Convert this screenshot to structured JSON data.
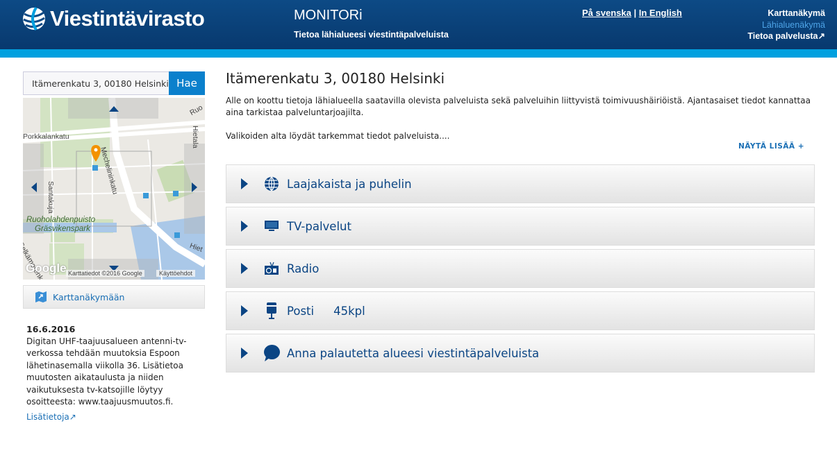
{
  "header": {
    "brand": "Viestintävirasto",
    "app_title": "MONITORi",
    "subtitle": "Tietoa lähialueesi viestintäpalveluista",
    "lang": {
      "swedish": "På svenska",
      "separator": "|",
      "english": "In English"
    },
    "nav": [
      {
        "label": "Karttanäkymä",
        "active": false
      },
      {
        "label": "Lähialuenäkymä",
        "active": true
      },
      {
        "label": "Tietoa palvelusta",
        "external": true
      }
    ]
  },
  "search": {
    "value": "Itämerenkatu 3, 00180 Helsinki",
    "button": "Hae"
  },
  "map": {
    "labels": {
      "porkkalankatu": "Porkkalankatu",
      "mechelininkatu": "Mechelininkatu",
      "santakuja": "Santakuja",
      "park1": "Ruoholahdenpuisto",
      "park2": "Gräsvikenspark",
      "ruo": "Ruo",
      "hietal": "Hietala",
      "hiet": "Hiet",
      "selka": "Selkämerenk",
      "kat": "kat"
    },
    "logo": "Google",
    "attribution": "Karttatiedot ©2016 Google",
    "terms": "Käyttöehdot",
    "marker_color": "#f39200"
  },
  "map_button": "Karttanäkymään",
  "news": {
    "date": "16.6.2016",
    "text": "Digitan UHF-taajuusalueen antenni-tv-verkossa tehdään muutoksia Espoon lähetinasemalla viikolla 36. Lisätietoa muutosten aikataulusta ja niiden vaikutuksesta tv-katsojille löytyy osoitteesta: www.taajuusmuutos.fi.",
    "link": "Lisätietoja"
  },
  "main": {
    "title": "Itämerenkatu 3, 00180 Helsinki",
    "intro": "Alle on koottu tietoja lähialueella saatavilla olevista palveluista sekä palveluihin liittyvistä toimivuushäiriöistä. Ajantasaiset tiedot kannattaa aina tarkistaa palveluntarjoajilta.",
    "intro2": "Valikoiden alta löydät tarkemmat tiedot palveluista....",
    "show_more": "NÄYTÄ LISÄÄ +",
    "sections": [
      {
        "label": "Laajakaista ja puhelin",
        "icon": "globe-icon"
      },
      {
        "label": "TV-palvelut",
        "icon": "tv-icon"
      },
      {
        "label": "Radio",
        "icon": "radio-icon"
      },
      {
        "label": "Posti",
        "count": "45kpl",
        "icon": "mailbox-icon"
      },
      {
        "label": "Anna palautetta alueesi viestintäpalveluista",
        "icon": "speech-bubble-icon"
      }
    ]
  },
  "colors": {
    "header": "#0d4a85",
    "stripe": "#00a0df",
    "accent": "#0b4584",
    "link": "#1a6fb5"
  }
}
